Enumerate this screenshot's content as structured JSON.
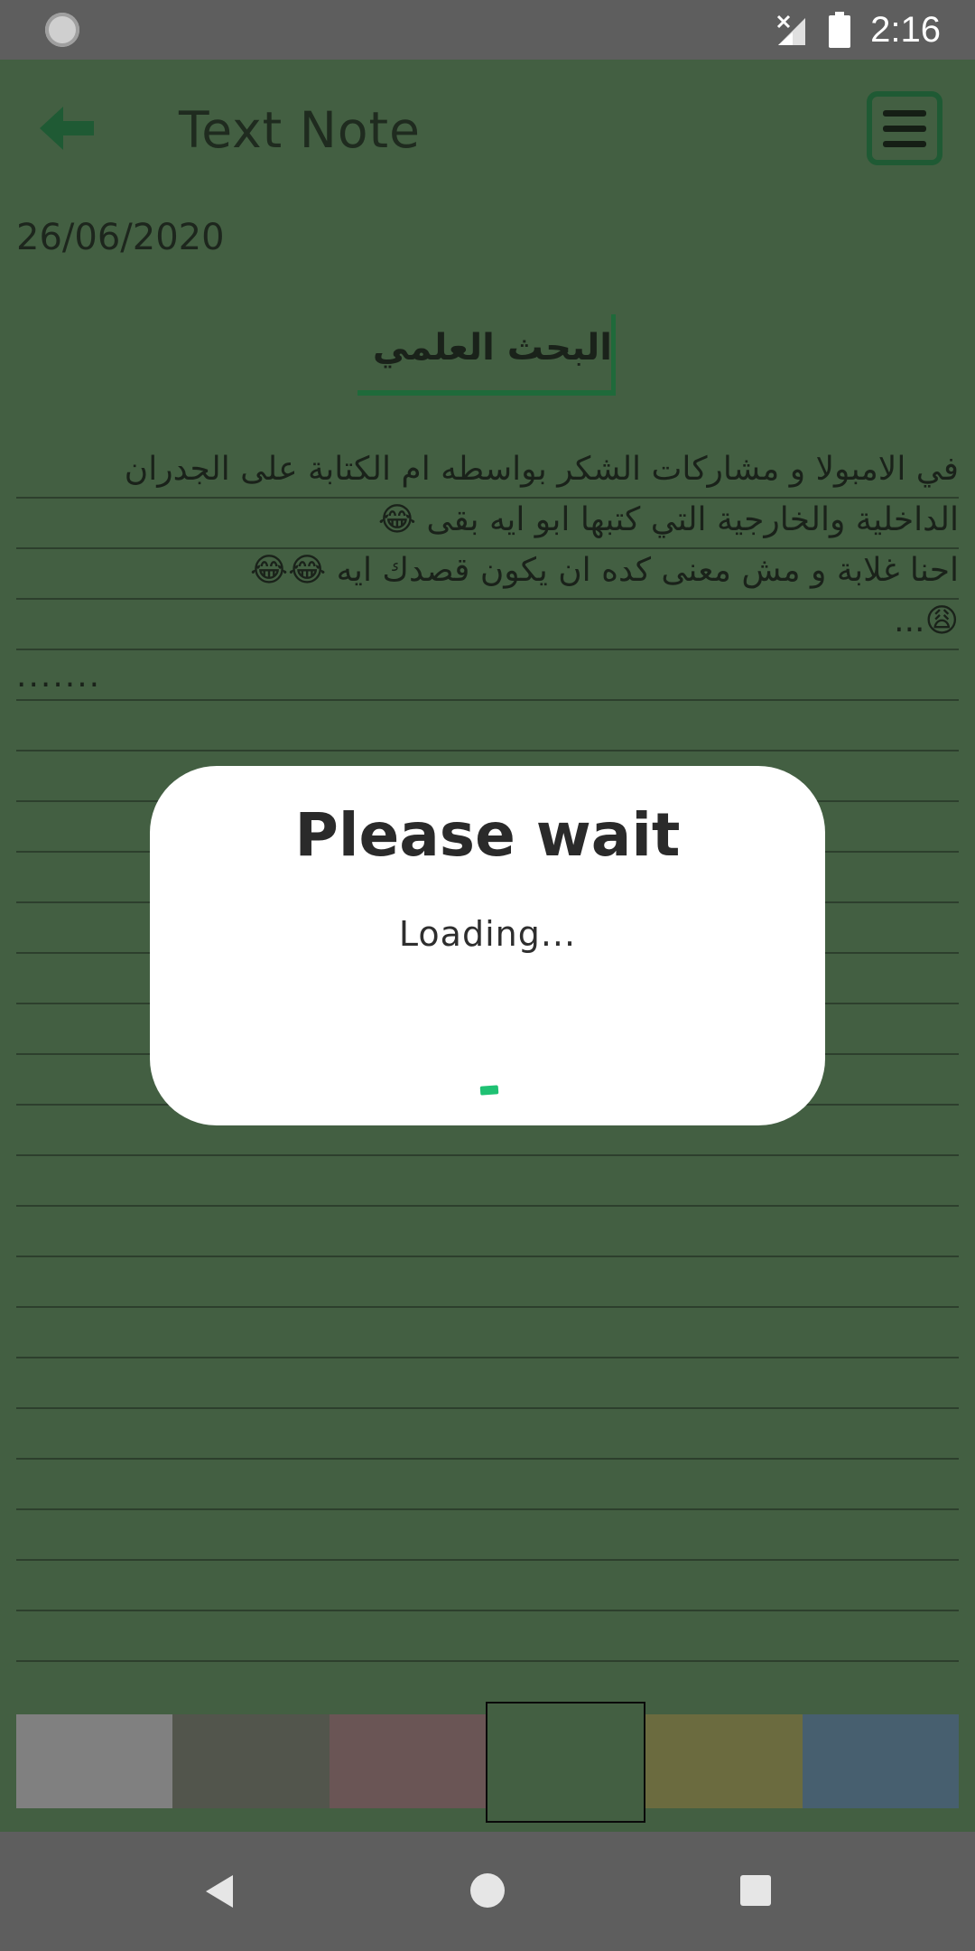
{
  "status_bar": {
    "time": "2:16",
    "icons": [
      "sync-icon",
      "signal-icon",
      "battery-icon"
    ]
  },
  "app_bar": {
    "title": "Text Note",
    "icons": [
      "back-arrow-icon",
      "menu-icon"
    ]
  },
  "note": {
    "date": "26/06/2020",
    "title": "البحث العلمي",
    "body": "في الامبولا و مشاركات الشكر بواسطه ام الكتابة على الجدران الداخلية والخارجية التي كتبها ابو ايه بقى 😂\nاحنا غلابة و مش معنى كده ان يكون قصدك ايه 😂😂\n😩...",
    "trailing": ".......",
    "title_cursor_color": "#1f6a3a"
  },
  "palette": {
    "colors": [
      "#808080",
      "#52554c",
      "#6a5555",
      "#435f42",
      "#6b6b3f",
      "#475f6f"
    ],
    "selected_index": 3
  },
  "dialog": {
    "title": "Please wait",
    "message": "Loading...",
    "spinner_color": "#1fc173"
  },
  "nav_bar": {
    "icons": [
      "nav-back-icon",
      "nav-home-icon",
      "nav-recents-icon"
    ]
  },
  "colors": {
    "background": "#435f42",
    "status_bar": "#5e5e5e",
    "accent": "#1f5a34"
  }
}
